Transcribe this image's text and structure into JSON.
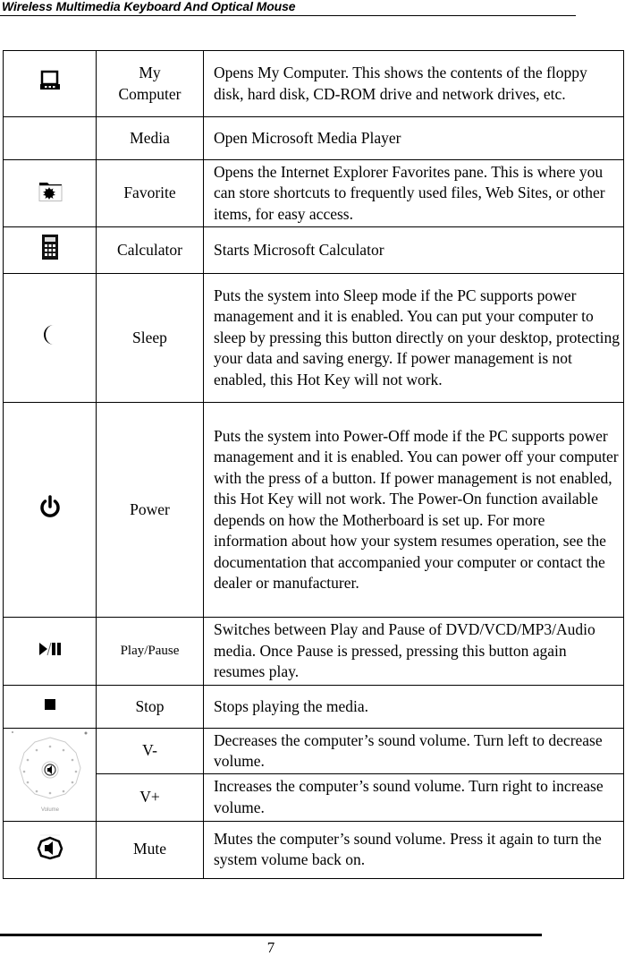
{
  "document": {
    "running_header": "Wireless Multimedia Keyboard And Optical Mouse",
    "page_number": "7"
  },
  "hotkeys": [
    {
      "icon": "computer-icon",
      "name": "My\nComputer",
      "description": "Opens My Computer. This shows the contents of the floppy disk, hard disk, CD-ROM drive and network drives, etc."
    },
    {
      "icon": "",
      "name": "Media",
      "description": "Open Microsoft Media Player"
    },
    {
      "icon": "favorites-folder-icon",
      "name": "Favorite",
      "description": "Opens the Internet Explorer Favorites pane. This is where you can store shortcuts to frequently used files, Web Sites, or other items, for easy access."
    },
    {
      "icon": "calculator-icon",
      "name": "Calculator",
      "description": "Starts Microsoft Calculator"
    },
    {
      "icon": "moon-icon",
      "name": "Sleep",
      "description": "Puts the system into Sleep mode if the PC supports power management and it is enabled. You can put your computer to sleep by pressing this button directly on your desktop, protecting your data and saving energy. If power management is not enabled, this Hot Key will not work."
    },
    {
      "icon": "power-icon",
      "name": "Power",
      "description": "Puts the system into Power-Off mode if the PC supports power management and it is enabled. You can power off your computer with the press of a button. If power management is not enabled, this Hot Key will not work. The Power-On function available depends on how the Motherboard is set up. For more information about how your system resumes operation, see the documentation that accompanied your computer or contact the dealer or manufacturer."
    },
    {
      "icon": "play-pause-icon",
      "name": "Play/Pause",
      "description": "Switches between Play and Pause of DVD/VCD/MP3/Audio media. Once Pause is pressed, pressing this button again resumes play."
    },
    {
      "icon": "stop-icon",
      "name": "Stop",
      "description": "Stops playing the media."
    },
    {
      "icon": "volume-dial-icon",
      "name": "V-",
      "description": "Decreases the computer’s sound volume. Turn left to decrease volume."
    },
    {
      "icon": "volume-dial-icon",
      "name": "V+",
      "description": "Increases the computer’s sound volume. Turn right to increase volume."
    },
    {
      "icon": "mute-icon",
      "name": "Mute",
      "description": "Mutes the computer’s sound volume. Press it again to turn the system volume back on."
    }
  ],
  "volume_dial_label": "Volume"
}
